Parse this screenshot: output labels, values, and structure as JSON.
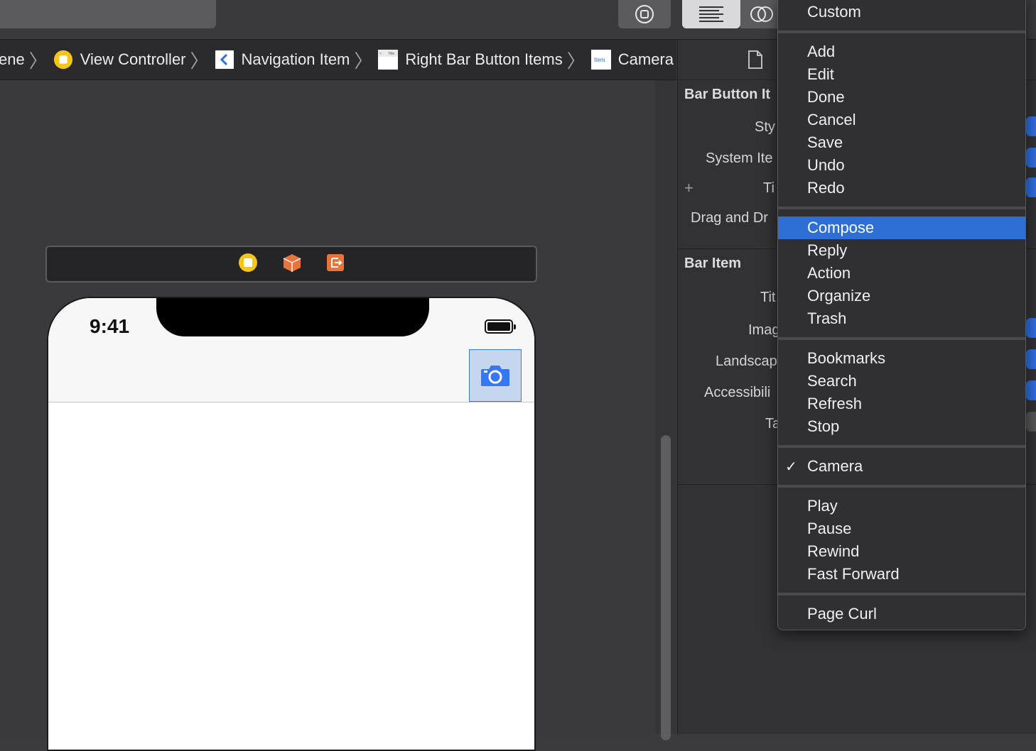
{
  "breadcrumb": {
    "items": [
      {
        "label": "ene"
      },
      {
        "label": "View Controller"
      },
      {
        "label": "Navigation Item"
      },
      {
        "label": "Right Bar Button Items"
      },
      {
        "label": "Camera"
      }
    ],
    "title_icon_text": "Title",
    "item_icon_text": "Item"
  },
  "phone": {
    "time": "9:41"
  },
  "inspector": {
    "section1": "Bar Button It",
    "style_label": "Sty",
    "system_item_label": "System Ite",
    "plus": "+",
    "title_label": "Ti",
    "drag_label": "Drag and Dr",
    "section2": "Bar Item",
    "bar_title_label": "Tit",
    "image_label": "Imag",
    "landscape_label": "Landscap",
    "accessibility_label": "Accessibili",
    "tag_label": "Ta"
  },
  "menu": {
    "items": [
      {
        "label": "Custom"
      },
      {
        "label": "Add"
      },
      {
        "label": "Edit"
      },
      {
        "label": "Done"
      },
      {
        "label": "Cancel"
      },
      {
        "label": "Save"
      },
      {
        "label": "Undo"
      },
      {
        "label": "Redo"
      },
      {
        "label": "Compose",
        "highlighted": true
      },
      {
        "label": "Reply"
      },
      {
        "label": "Action"
      },
      {
        "label": "Organize"
      },
      {
        "label": "Trash"
      },
      {
        "label": "Bookmarks"
      },
      {
        "label": "Search"
      },
      {
        "label": "Refresh"
      },
      {
        "label": "Stop"
      },
      {
        "label": "Camera",
        "checked": true
      },
      {
        "label": "Play"
      },
      {
        "label": "Pause"
      },
      {
        "label": "Rewind"
      },
      {
        "label": "Fast Forward"
      },
      {
        "label": "Page Curl"
      }
    ],
    "checkmark": "✓"
  },
  "colors": {
    "accent": "#2e6fd6",
    "camera_blue": "#3478f6",
    "scene_yellow": "#f5c518",
    "scene_orange": "#e8733b"
  }
}
